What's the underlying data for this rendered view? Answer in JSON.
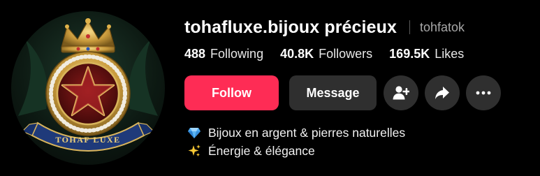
{
  "profile": {
    "display_name": "tohafluxe.bijoux précieux",
    "username": "tohfatok",
    "avatar_icon": "royal-crest-logo-icon",
    "avatar_text": "TOHAF LUXE"
  },
  "stats": [
    {
      "value": "488",
      "label": "Following"
    },
    {
      "value": "40.8K",
      "label": "Followers"
    },
    {
      "value": "169.5K",
      "label": "Likes"
    }
  ],
  "actions": {
    "follow_label": "Follow",
    "message_label": "Message",
    "add_friend_icon": "add-friend-icon",
    "share_icon": "share-arrow-icon",
    "more_icon": "more-horizontal-icon"
  },
  "bio": {
    "lines": [
      {
        "icon": "gem-icon",
        "text": "Bijoux en argent & pierres naturelles"
      },
      {
        "icon": "sparkles-icon",
        "text": "Énergie & élégance"
      }
    ]
  },
  "colors": {
    "accent": "#fe2c55",
    "button_bg": "#2f2f2f",
    "background": "#000000",
    "muted_text": "#a8a8a8"
  }
}
